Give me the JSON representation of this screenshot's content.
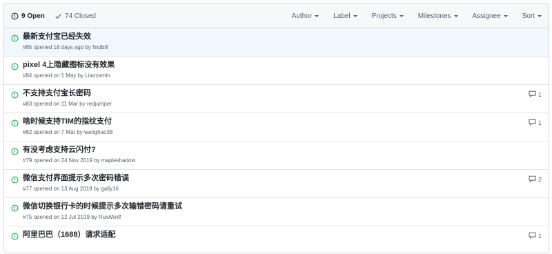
{
  "header": {
    "open_count": "9 Open",
    "closed_count": "74 Closed",
    "filters": [
      "Author",
      "Label",
      "Projects",
      "Milestones",
      "Assignee",
      "Sort"
    ]
  },
  "colors": {
    "open_green": "#28a745",
    "highlight_row": "#f1f8ff",
    "header_bg": "#f6f8fa"
  },
  "issues": [
    {
      "title": "最新支付宝已经失效",
      "number": "#85",
      "opened": "opened 18 days ago by",
      "author": "findbill",
      "comments": ""
    },
    {
      "title": "pixel 4上隐藏图标没有效果",
      "number": "#84",
      "opened": "opened on 1 May by",
      "author": "Liaozemin",
      "comments": ""
    },
    {
      "title": "不支持支付宝长密码",
      "number": "#83",
      "opened": "opened on 11 Mar by",
      "author": "redjumper",
      "comments": "1"
    },
    {
      "title": "啥时候支持TIM的指纹支付",
      "number": "#82",
      "opened": "opened on 7 Mar by",
      "author": "wanghao38",
      "comments": "1"
    },
    {
      "title": "有没考虑支持云闪付?",
      "number": "#79",
      "opened": "opened on 24 Nov 2019 by",
      "author": "mapleshadow",
      "comments": ""
    },
    {
      "title": "微信支付界面提示多次密码错误",
      "number": "#77",
      "opened": "opened on 13 Aug 2019 by",
      "author": "gally16",
      "comments": "2"
    },
    {
      "title": "微信切换银行卡的时候提示多次输错密码请重试",
      "number": "#75",
      "opened": "opened on 12 Jul 2019 by",
      "author": "RuioWolf",
      "comments": ""
    },
    {
      "title": "阿里巴巴（1688）请求适配",
      "number": "",
      "opened": "",
      "author": "",
      "comments": "1"
    }
  ]
}
